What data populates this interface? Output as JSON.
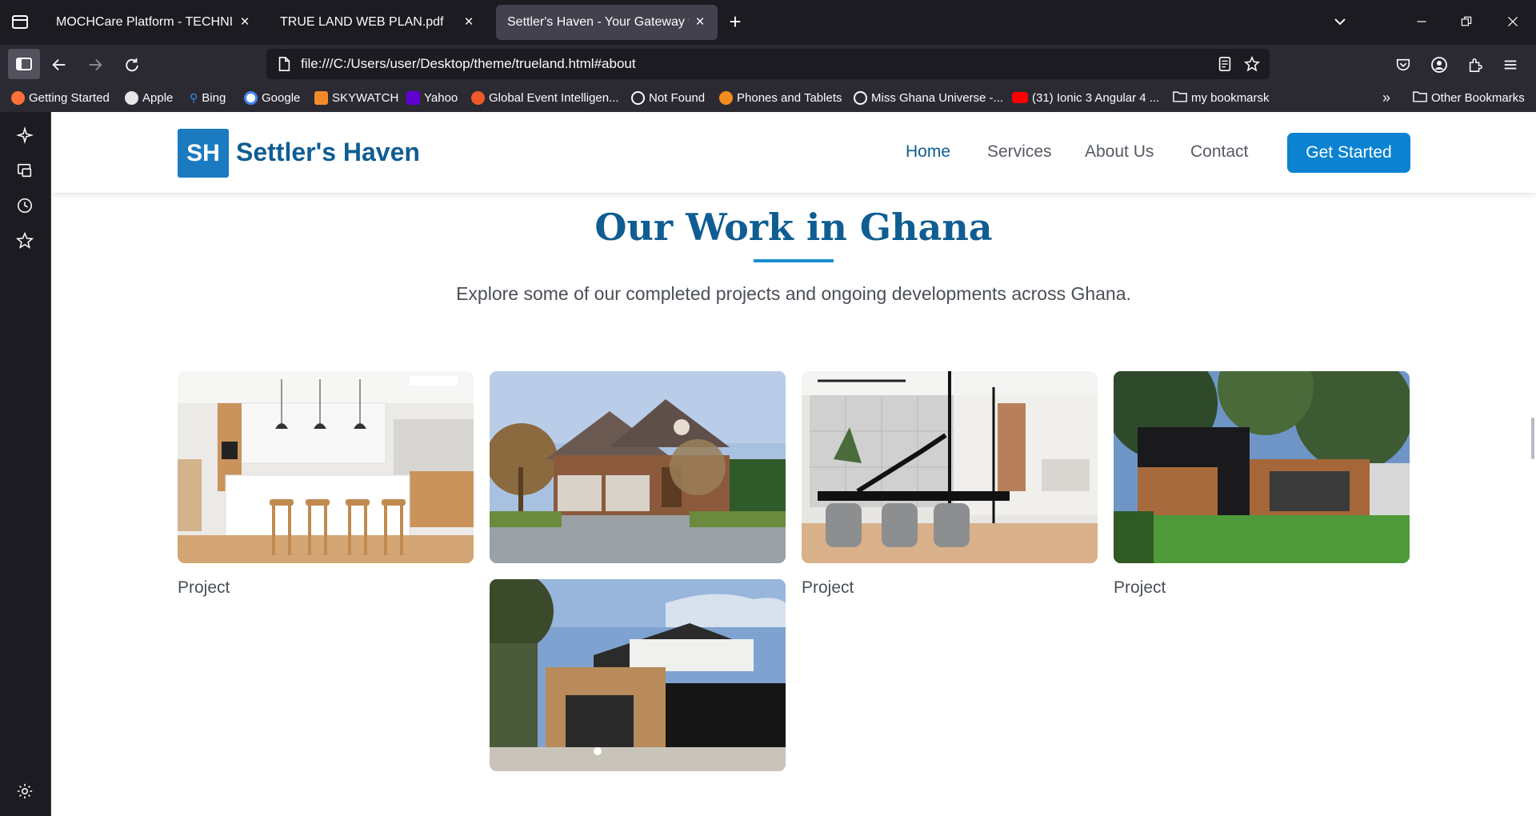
{
  "browser": {
    "tabs": [
      {
        "title": "MOCHCare Platform - TECHNICAL D",
        "active": false
      },
      {
        "title": "TRUE LAND WEB PLAN.pdf",
        "active": false
      },
      {
        "title": "Settler's Haven - Your Gateway to B",
        "active": true
      }
    ],
    "new_tab_label": "+",
    "url": "file:///C:/Users/user/Desktop/theme/trueland.html#about",
    "bookmarks": [
      {
        "label": "Getting Started",
        "color": "#ff7139"
      },
      {
        "label": "Apple",
        "color": "#e6e6e6"
      },
      {
        "label": "Bing",
        "color": "#2f8fe8"
      },
      {
        "label": "Google",
        "color": "#4285f4"
      },
      {
        "label": "SKYWATCH",
        "color": "#f28c28"
      },
      {
        "label": "Yahoo",
        "color": "#6001d2"
      },
      {
        "label": "Global Event Intelligen...",
        "color": "#f05a28"
      },
      {
        "label": "Not Found",
        "color": "#fbfbfe"
      },
      {
        "label": "Phones and Tablets",
        "color": "#f68b1e"
      },
      {
        "label": "Miss Ghana Universe -...",
        "color": "#fbfbfe"
      },
      {
        "label": "(31) Ionic 3 Angular 4 ...",
        "color": "#ff0000"
      },
      {
        "label": "my bookmarsk",
        "color": "#fbfbfe"
      }
    ],
    "other_bookmarks": "Other Bookmarks"
  },
  "site": {
    "logo_mark": "SH",
    "logo_text": "Settler's Haven",
    "nav": [
      {
        "label": "Home",
        "active": true
      },
      {
        "label": "Services",
        "active": false
      },
      {
        "label": "About Us",
        "active": false
      },
      {
        "label": "Contact",
        "active": false
      }
    ],
    "cta": "Get Started",
    "accent": "#0b83d0",
    "brand": "#0f5d92"
  },
  "section": {
    "title": "Our Work in Ghana",
    "subtitle": "Explore some of our completed projects and ongoing developments across Ghana.",
    "projects": [
      {
        "label": "Project",
        "scene": "kitchen"
      },
      {
        "label": "",
        "scene": "brick-house"
      },
      {
        "label": "Project",
        "scene": "dining-room"
      },
      {
        "label": "Project",
        "scene": "modern-house"
      },
      {
        "label": "",
        "scene": "timber-house"
      }
    ]
  }
}
